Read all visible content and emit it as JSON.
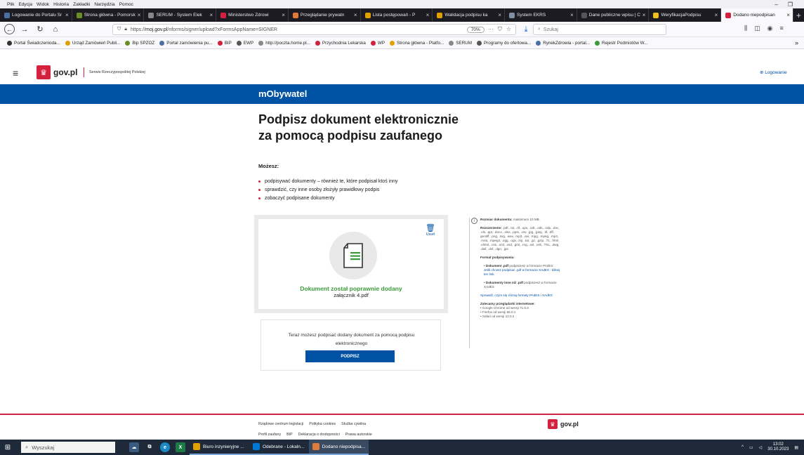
{
  "browser": {
    "menu": [
      "Plik",
      "Edycja",
      "Widok",
      "Historia",
      "Zakładki",
      "Narzędzia",
      "Pomoc"
    ],
    "tabs": [
      {
        "label": "Logowanie do Portalu Śr",
        "color": "#4a6fa5"
      },
      {
        "label": "Strona główna - Pomorsk",
        "color": "#6b8e23"
      },
      {
        "label": "SERUM - System Elek",
        "color": "#888888"
      },
      {
        "label": "Ministerstwo Zdrowi",
        "color": "#d4213d"
      },
      {
        "label": "Przeglądanie prywatn",
        "color": "#e07b39"
      },
      {
        "label": "Lista postępowań - P",
        "color": "#e0a000"
      },
      {
        "label": "Walidacja podpisu ka",
        "color": "#e0a000"
      },
      {
        "label": "System EKRS",
        "color": "#7f8fa6"
      },
      {
        "label": "Dane publiczne wpisu | C",
        "color": "#555555"
      },
      {
        "label": "WeryfikacjaPodpisu",
        "color": "#f0c020"
      },
      {
        "label": "Dodano niepodpisan",
        "color": "#d4213d",
        "active": true
      }
    ],
    "url_prefix": "https://",
    "url_host": "moj.gov.pl",
    "url_path": "/nforms/signer/upload?xFormsAppName=SIGNER",
    "zoom": "70%",
    "search_placeholder": "Szukaj",
    "bookmarks": [
      {
        "label": "Portal Świadczenioda...",
        "color": "#333333"
      },
      {
        "label": "Urząd Zamówień Publi...",
        "color": "#e0a000"
      },
      {
        "label": "Bip SPZOZ",
        "color": "#6b8e23"
      },
      {
        "label": "Portal zamówienia pu...",
        "color": "#4a6fa5"
      },
      {
        "label": "BIP",
        "color": "#d4213d"
      },
      {
        "label": "EWP",
        "color": "#555555"
      },
      {
        "label": "http://poczta.home.pl...",
        "color": "#888888"
      },
      {
        "label": "Przychodnia Lekarska",
        "color": "#d4213d"
      },
      {
        "label": "WP",
        "color": "#d4213d"
      },
      {
        "label": "Strona główna - Platfo...",
        "color": "#e0a000"
      },
      {
        "label": "SERUM",
        "color": "#888888"
      },
      {
        "label": "Programy do ofertowa...",
        "color": "#555555"
      },
      {
        "label": "RynekZdrowia - portal...",
        "color": "#4a6fa5"
      },
      {
        "label": "Rejestr Podmiotów W...",
        "color": "#3a9a3a"
      }
    ]
  },
  "header": {
    "logo_text": "gov.pl",
    "serwis": "Serwis Rzeczypospolitej Polskiej",
    "login": "Logowanie"
  },
  "banner": {
    "title": "mObywatel"
  },
  "main": {
    "title_line1": "Podpisz dokument elektronicznie",
    "title_line2": "za pomocą podpisu zaufanego",
    "can_label": "Możesz:",
    "bullets": [
      "podpisywać dokumenty – również te, które podpisał ktoś inny",
      "sprawdzić, czy inne osoby złożyły prawidłowy podpis",
      "zobaczyć podpisane dokumenty"
    ],
    "upload": {
      "delete_label": "Usuń",
      "success": "Dokument został poprawnie dodany",
      "filename": "załącznik 4.pdf"
    },
    "sign": {
      "text": "Teraz możesz podpisać dodany dokument za pomocą podpisu elektronicznego",
      "button": "PODPISZ"
    }
  },
  "info": {
    "size_label": "Rozmiar dokumentu:",
    "size_value": "maksimum 10 MB.",
    "ext_label": "Rozszerzenie:",
    "ext_value": ".pdf, .txt, .rtf, .xps, .odt, .ods, .odp, .doc, .xls, .ppt, .docx, .xlsx, .pptx, .csv, .jpg, .jpeg, .tif, .tiff, geotiff, .png, .svg, .wav, .mp3, .avi, .mpg, .mpeg, .mp4, .m4a, .mpeg4, .ogg, .ogv, .zip, .tar, .gz, .gzip, .7z, .html, .xhtml, .css, .xml, .xsd, .gml, .rng, .xsl, .xslt, .TSL, .dwg, .dwf, .dxf, .dgn, .jp2.",
    "format_label": "Format podpisywania:",
    "pdf_label": "Dokument .pdf",
    "pdf_text": "podpiszesz w formacie PAdES",
    "pdf_link": "Jeśli chcesz podpisać .pdf w formacie XAdES - kliknij ten link.",
    "other_label": "Dokumenty inne niż .pdf",
    "other_text": "podpiszesz w formacie XAdES",
    "diff_link": "Sprawdź, czym się różnią formaty PAdES i XAdES",
    "browsers_label": "Zalecamy przeglądarki internetowe:",
    "browsers": [
      "Google Chrome od wersji 71.0.3",
      "Firefox od wersji 65.0.1",
      "Safari od wersji 12.0.2"
    ]
  },
  "footer": {
    "links1": [
      "Rządowe centrum legislacji",
      "Polityka cookies",
      "Służba cywilna"
    ],
    "links2": [
      "Profil zaufany",
      "BIP",
      "Deklaracja o dostępności",
      "Prawa autorskie"
    ],
    "logo_text": "gov.pl"
  },
  "taskbar": {
    "search": "Wyszukaj",
    "apps": [
      {
        "label": "Biuro inzynieryjne ...",
        "color": "#e0a000"
      },
      {
        "label": "Odebrane - Lokaln...",
        "color": "#0078d4"
      },
      {
        "label": "Dodano niepodpisa...",
        "color": "#e07b39",
        "active": true
      }
    ],
    "time": "13:02",
    "date": "30.10.2023"
  }
}
